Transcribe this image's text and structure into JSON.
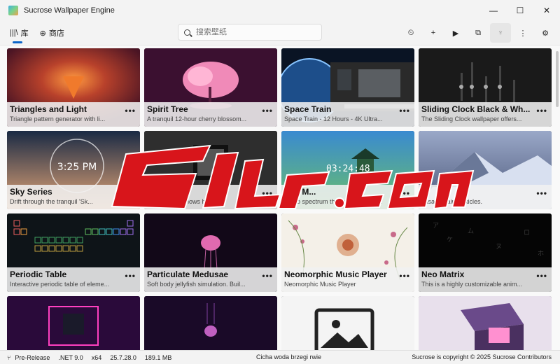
{
  "window": {
    "title": "Sucrose Wallpaper Engine",
    "controls": [
      "—",
      "☐",
      "✕"
    ]
  },
  "nav": {
    "tabs": [
      {
        "icon": "|||\\",
        "label": "库",
        "active": true
      },
      {
        "icon": "⊕",
        "label": "商店",
        "active": false
      }
    ],
    "search": {
      "placeholder": "搜索壁纸"
    },
    "tools": [
      "⏲",
      "+",
      "▶",
      "⧉",
      "♆",
      "⋮",
      "⚙"
    ]
  },
  "wallpapers": [
    {
      "title": "Triangles and Light",
      "desc": "Triangle pattern generator with li...",
      "theme": "triangles"
    },
    {
      "title": "Spirit Tree",
      "desc": "A tranquil 12-hour cherry blossom...",
      "theme": "spirit"
    },
    {
      "title": "Space Train",
      "desc": "Space Train - 12 Hours - 4K Ultra...",
      "theme": "train"
    },
    {
      "title": "Sliding Clock Black & Wh...",
      "desc": "The Sliding Clock wallpaper offers...",
      "theme": "clock"
    },
    {
      "title": "Sky Series",
      "desc": "Drift through the tranquil 'Sk...",
      "theme": "sky"
    },
    {
      "title": "Si...tem",
      "desc": "...paper that shows har...",
      "theme": "system"
    },
    {
      "title": "Ray M...",
      "desc": "Audio spectrum that reacts with s...",
      "theme": "ray"
    },
    {
      "title": "...",
      "desc": "...isable rain particles.",
      "theme": "rain"
    },
    {
      "title": "Periodic Table",
      "desc": "Interactive periodic table of eleme...",
      "theme": "periodic"
    },
    {
      "title": "Particulate Medusae",
      "desc": "Soft body jellyfish simulation. Buil...",
      "theme": "medusae"
    },
    {
      "title": "Neomorphic Music Player",
      "desc": "Neomorphic Music Player",
      "theme": "neomorphic"
    },
    {
      "title": "Neo Matrix",
      "desc": "This is a highly customizable anim...",
      "theme": "matrix"
    },
    {
      "title": "",
      "desc": "",
      "theme": "neon"
    },
    {
      "title": "",
      "desc": "",
      "theme": "jelly"
    },
    {
      "title": "",
      "desc": "",
      "theme": "placeholder"
    },
    {
      "title": "",
      "desc": "",
      "theme": "room"
    }
  ],
  "card_more": "•••",
  "status": {
    "channel": "Pre-Release",
    "runtime": ".NET 9.0",
    "arch": "x64",
    "version": "25.7.28.0",
    "memory": "189.1 MB",
    "center_text": "Cicha woda brzegi rwie",
    "copyright": "Sucrose is copyright © 2025 Sucrose Contributors"
  },
  "clock_overlay": "03:24:48",
  "watermark_text": "Soft.com"
}
